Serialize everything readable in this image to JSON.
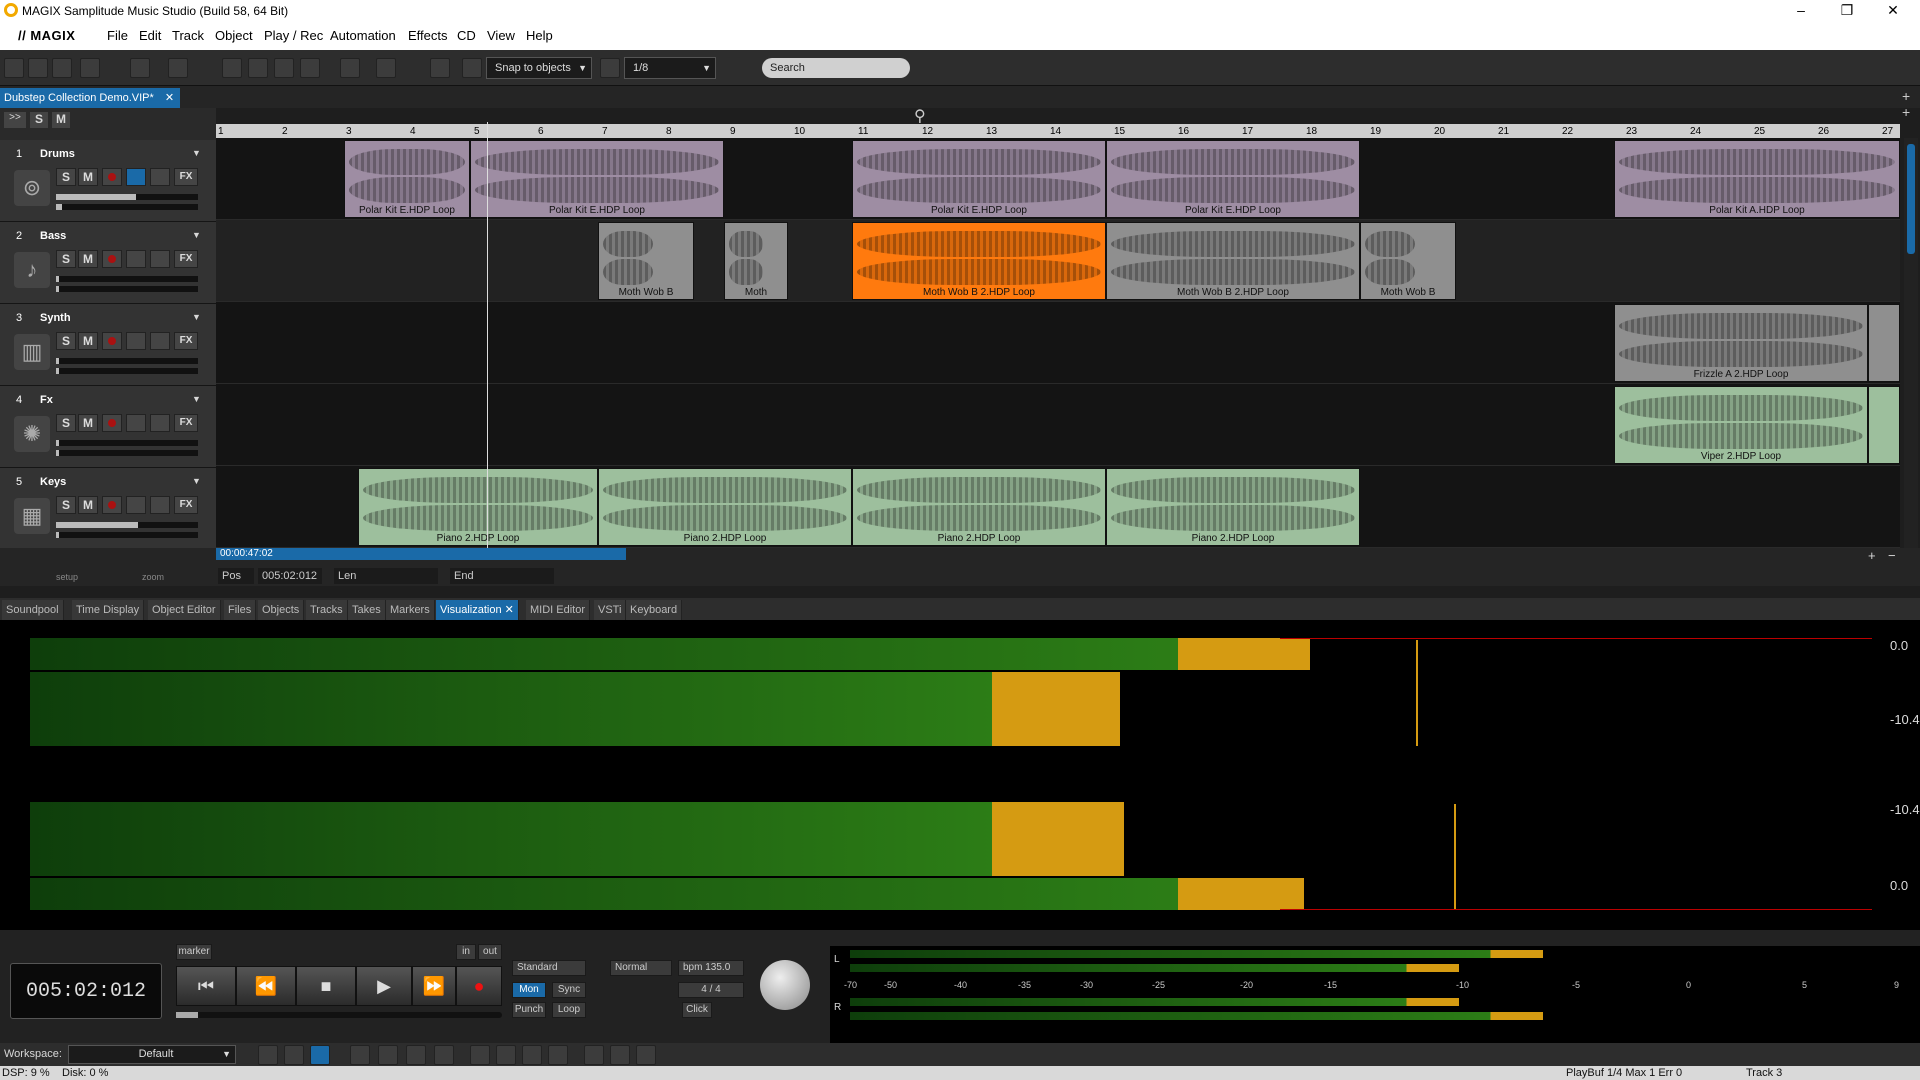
{
  "window": {
    "title": "MAGIX Samplitude Music Studio (Build 58, 64 Bit)",
    "minimize": "–",
    "maximize": "❐",
    "close": "✕"
  },
  "menu": {
    "brand": "// MAGIX",
    "items": [
      "File",
      "Edit",
      "Track",
      "Object",
      "Play / Rec",
      "Automation",
      "Effects",
      "CD",
      "View",
      "Help"
    ]
  },
  "toolbar": {
    "snap_label": "Snap to objects",
    "grid_value": "1/8",
    "search_placeholder": "Search"
  },
  "project_tab": {
    "label": "Dubstep Collection Demo.VIP*",
    "close": "✕"
  },
  "track_header_top": {
    "solo": "S",
    "mute": "M"
  },
  "tracks": [
    {
      "num": "1",
      "name": "Drums",
      "icon": "drums-icon",
      "glyph": "⊚"
    },
    {
      "num": "2",
      "name": "Bass",
      "icon": "guitar-icon",
      "glyph": "♪"
    },
    {
      "num": "3",
      "name": "Synth",
      "icon": "synth-icon",
      "glyph": "▥"
    },
    {
      "num": "4",
      "name": "Fx",
      "icon": "fx-icon",
      "glyph": "✺"
    },
    {
      "num": "5",
      "name": "Keys",
      "icon": "keys-icon",
      "glyph": "▦"
    }
  ],
  "track_buttons": {
    "solo": "S",
    "mute": "M",
    "fx": "FX"
  },
  "ruler": [
    "1",
    "2",
    "3",
    "4",
    "5",
    "6",
    "7",
    "8",
    "9",
    "10",
    "11",
    "12",
    "13",
    "14",
    "15",
    "16",
    "17",
    "18",
    "19",
    "20",
    "21",
    "22",
    "23",
    "24",
    "25",
    "26",
    "27"
  ],
  "clips": {
    "drums": [
      {
        "label": "Polar Kit E.HDP  Loop"
      },
      {
        "label": "Polar Kit E.HDP  Loop"
      },
      {
        "label": "Polar Kit E.HDP  Loop"
      },
      {
        "label": "Polar Kit E.HDP  Loop"
      },
      {
        "label": "Polar Kit A.HDP  Loop"
      }
    ],
    "bass": [
      {
        "label": "Moth Wob B"
      },
      {
        "label": "Moth"
      },
      {
        "label": "Moth Wob B 2.HDP  Loop"
      },
      {
        "label": "Moth Wob B 2.HDP  Loop"
      },
      {
        "label": "Moth Wob B"
      }
    ],
    "synth": [
      {
        "label": "Frizzle A 2.HDP  Loop"
      }
    ],
    "fx": [
      {
        "label": "Viper 2.HDP  Loop"
      }
    ],
    "keys": [
      {
        "label": "Piano 2.HDP  Loop"
      },
      {
        "label": "Piano 2.HDP  Loop"
      },
      {
        "label": "Piano 2.HDP  Loop"
      },
      {
        "label": "Piano 2.HDP  Loop"
      }
    ]
  },
  "arrange_footer": {
    "scroll_time": "00:00:47:02",
    "pos_label": "Pos",
    "pos_value": "005:02:012",
    "len_label": "Len",
    "end_label": "End",
    "setup": "setup",
    "zoom": "zoom"
  },
  "lower_tabs": [
    "Soundpool",
    "Time Display",
    "Object Editor",
    "Files",
    "Objects",
    "Tracks",
    "Takes",
    "Markers",
    "Visualization",
    "MIDI Editor",
    "VSTi",
    "Keyboard"
  ],
  "active_tab": "Visualization",
  "viz_labels": {
    "l1": "0.0",
    "l2": "-10.4",
    "l3": "-10.4",
    "l4": "0.0"
  },
  "transport": {
    "time": "005:02:012",
    "buttons": [
      "⏮",
      "⏪",
      "■",
      "▶",
      "⏩",
      "●"
    ],
    "mode": "Standard",
    "mon": "Mon",
    "sync": "Sync",
    "punch": "Punch",
    "loop": "Loop",
    "normal": "Normal",
    "bpm": "bpm 135.0",
    "signature": "4 / 4",
    "click": "Click",
    "marker": "marker",
    "in": "in",
    "out": "out"
  },
  "master_scale": [
    "-70",
    "-50",
    "-40",
    "-35",
    "-30",
    "-25",
    "-20",
    "-15",
    "-10",
    "-5",
    "0",
    "5",
    "9"
  ],
  "master_labels": {
    "l": "L",
    "r": "R"
  },
  "workspace": {
    "label": "Workspace:",
    "value": "Default"
  },
  "status": {
    "dsp": "DSP: 9 %",
    "disk": "Disk:  0 %",
    "playbuf": "PlayBuf 1/4  Max 1  Err 0",
    "track": "Track 3"
  }
}
